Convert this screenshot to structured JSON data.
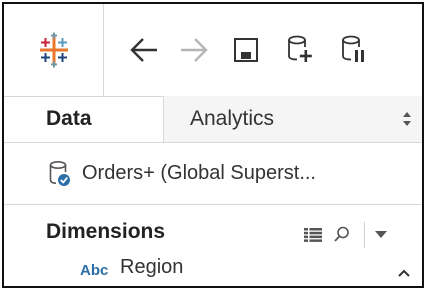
{
  "toolbar": {
    "logo_icon": "tableau-logo-icon",
    "buttons": [
      {
        "name": "back-button",
        "icon": "arrow-left-icon"
      },
      {
        "name": "forward-button",
        "icon": "arrow-right-icon"
      },
      {
        "name": "save-button",
        "icon": "save-icon"
      },
      {
        "name": "new-data-source-button",
        "icon": "database-add-icon"
      },
      {
        "name": "pause-updates-button",
        "icon": "database-pause-icon"
      }
    ]
  },
  "tabs": {
    "data_label": "Data",
    "analytics_label": "Analytics"
  },
  "datasource": {
    "label": "Orders+ (Global Superst..."
  },
  "dimensions": {
    "title": "Dimensions",
    "fields": [
      {
        "type": "Abc",
        "name": "Region"
      }
    ]
  },
  "colors": {
    "accent_blue": "#2d6ea8",
    "logo_orange": "#e8762b",
    "logo_blue": "#1f457e",
    "logo_teal": "#5b9bbd",
    "logo_red": "#c72037"
  }
}
